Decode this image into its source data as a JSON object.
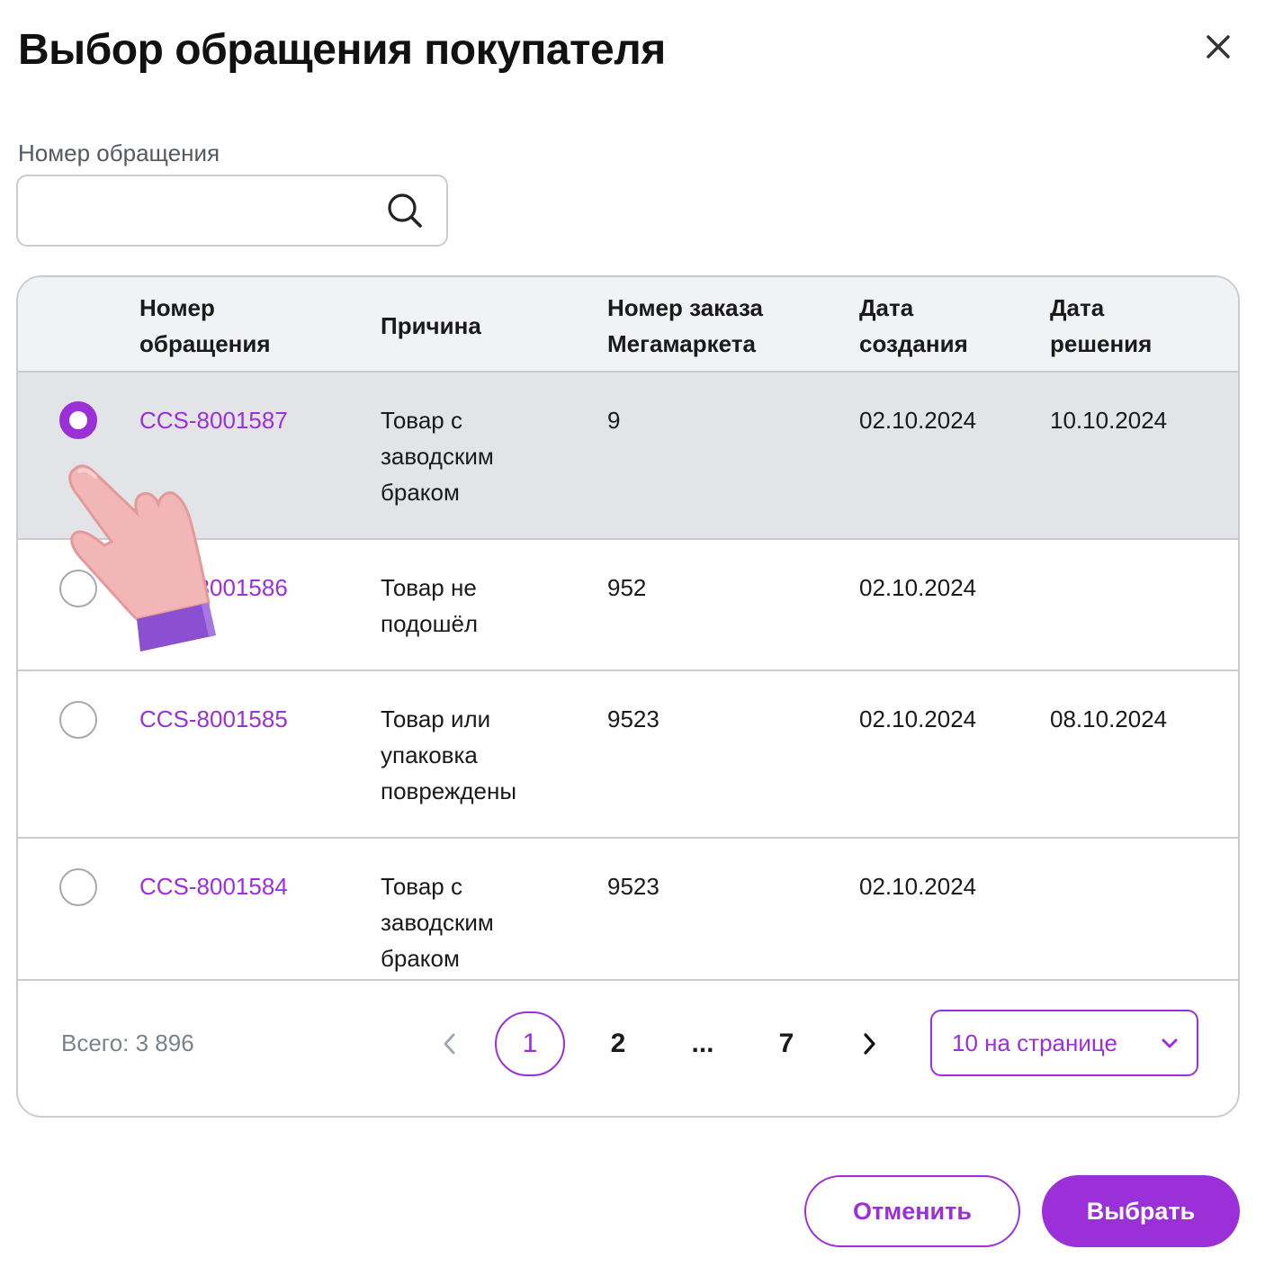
{
  "dialog": {
    "title": "Выбор обращения покупателя"
  },
  "search": {
    "label": "Номер обращения",
    "value": "",
    "placeholder": ""
  },
  "table": {
    "columns": [
      {
        "line1": "Номер",
        "line2": "обращения"
      },
      {
        "line1": "Причина",
        "line2": ""
      },
      {
        "line1": "Номер заказа",
        "line2": "Мегамаркета"
      },
      {
        "line1": "Дата",
        "line2": "создания"
      },
      {
        "line1": "Дата",
        "line2": "решения"
      }
    ],
    "rows": [
      {
        "selected": true,
        "id": "CCS-8001587",
        "reason": [
          "Товар с",
          "заводским",
          "браком"
        ],
        "order": "9",
        "created": "02.10.2024",
        "resolved": "10.10.2024"
      },
      {
        "selected": false,
        "id": "CCS-8001586",
        "reason": [
          "Товар не",
          "подошёл"
        ],
        "order": "952",
        "created": "02.10.2024",
        "resolved": ""
      },
      {
        "selected": false,
        "id": "CCS-8001585",
        "reason": [
          "Товар или",
          "упаковка",
          "повреждены"
        ],
        "order": "9523",
        "created": "02.10.2024",
        "resolved": "08.10.2024"
      },
      {
        "selected": false,
        "id": "CCS-8001584",
        "reason": [
          "Товар с",
          "заводским",
          "браком"
        ],
        "order": "9523",
        "created": "02.10.2024",
        "resolved": ""
      }
    ]
  },
  "pagination": {
    "total": "Всего: 3 896",
    "pages": [
      "1",
      "2",
      "...",
      "7"
    ],
    "current": "1",
    "per_page": "10 на странице"
  },
  "actions": {
    "cancel": "Отменить",
    "confirm": "Выбрать"
  },
  "colors": {
    "accent": "#9b30d9",
    "border": "#c9cdd2",
    "header_bg": "#f1f2f4",
    "selected_row_bg": "#e3e4e7"
  },
  "icons": [
    "close-icon",
    "search-icon",
    "chevron-left-icon",
    "chevron-right-icon",
    "chevron-down-icon",
    "pointing-hand-cursor"
  ]
}
